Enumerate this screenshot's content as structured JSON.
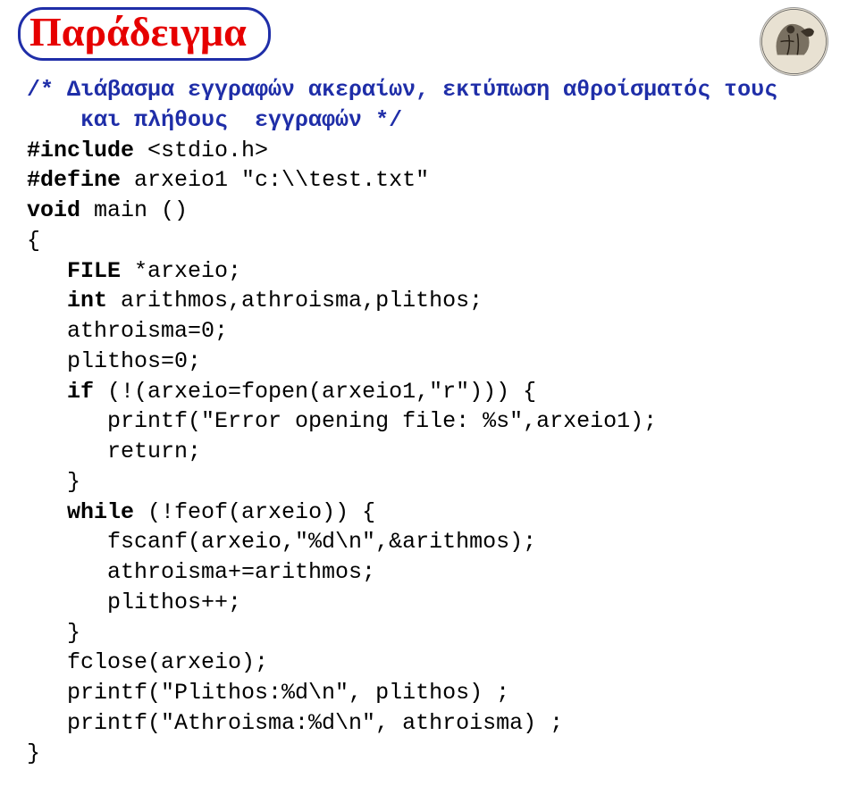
{
  "title": "Παράδειγμα",
  "code": {
    "c1": "/* Διάβασμα εγγραφών ακεραίων, εκτύπωση αθροίσματός τους",
    "c2": "    και πλήθους  εγγραφών */",
    "l1a": "#include",
    "l1b": " <stdio.h>",
    "l2a": "#define",
    "l2b": " arxeio1 \"c:\\\\test.txt\"",
    "l3a": "void",
    "l3b": " main ()",
    "l4": "{",
    "l5a": "   FILE",
    "l5b": " *arxeio;",
    "l6a": "   int",
    "l6b": " arithmos,athroisma,plithos;",
    "l7": "   athroisma=0;",
    "l8": "   plithos=0;",
    "l9a": "   if",
    "l9b": " (!(arxeio=fopen(arxeio1,\"r\"))) {",
    "l10": "      printf(\"Error opening file: %s\",arxeio1);",
    "l11": "      return;",
    "l12": "   }",
    "l13a": "   while",
    "l13b": " (!feof(arxeio)) {",
    "l14": "      fscanf(arxeio,\"%d\\n\",&arithmos);",
    "l15": "      athroisma+=arithmos;",
    "l16": "      plithos++;",
    "l17": "   }",
    "l18": "   fclose(arxeio);",
    "l19": "   printf(\"Plithos:%d\\n\", plithos) ;",
    "l20": "   printf(\"Athroisma:%d\\n\", athroisma) ;",
    "l21": "}"
  }
}
